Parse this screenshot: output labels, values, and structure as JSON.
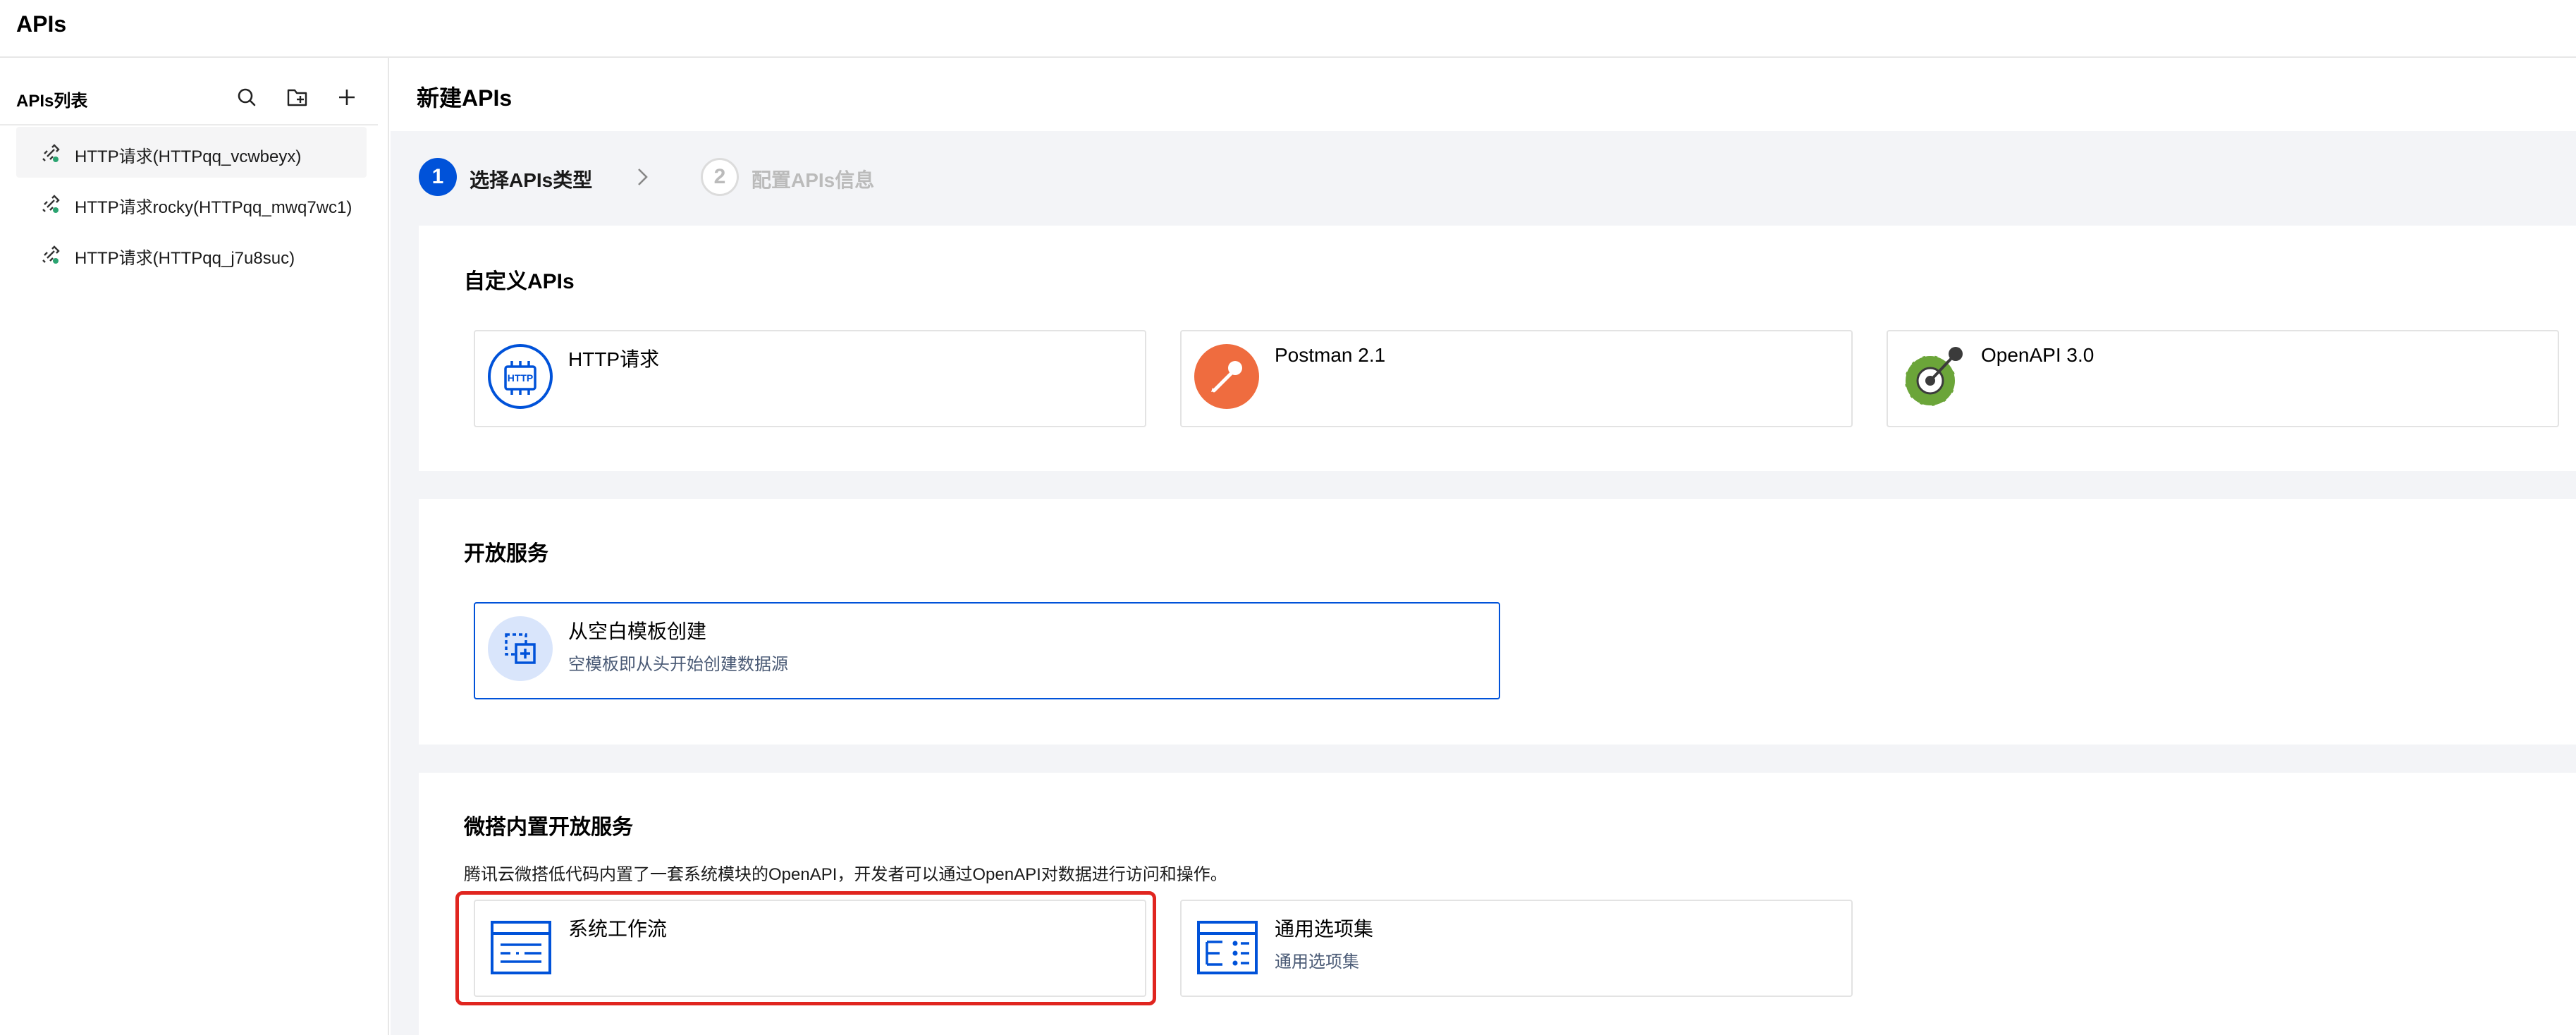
{
  "app": {
    "title": "APIs"
  },
  "sidebar": {
    "title": "APIs列表",
    "tools": [
      {
        "icon": "search-icon"
      },
      {
        "icon": "new-folder-icon"
      },
      {
        "icon": "plus-icon"
      }
    ],
    "items": [
      {
        "label": "HTTP请求(HTTPqq_vcwbeyx)",
        "active": true
      },
      {
        "label": "HTTP请求rocky(HTTPqq_mwq7wc1)",
        "active": false
      },
      {
        "label": "HTTP请求(HTTPqq_j7u8suc)",
        "active": false
      }
    ]
  },
  "main": {
    "title": "新建APIs",
    "steps": [
      {
        "num": "1",
        "label": "选择APIs类型",
        "state": "active"
      },
      {
        "num": "2",
        "label": "配置APIs信息",
        "state": "todo"
      }
    ]
  },
  "custom": {
    "title": "自定义APIs",
    "tiles": [
      {
        "title": "HTTP请求",
        "icon": "http-icon"
      },
      {
        "title": "Postman 2.1",
        "icon": "postman-icon"
      },
      {
        "title": "OpenAPI 3.0",
        "icon": "openapi-icon"
      }
    ]
  },
  "open": {
    "title": "开放服务",
    "tiles": [
      {
        "title": "从空白模板创建",
        "sub": "空模板即从头开始创建数据源",
        "icon": "blank-template-icon"
      }
    ]
  },
  "builtin": {
    "title": "微搭内置开放服务",
    "desc": "腾讯云微搭低代码内置了一套系统模块的OpenAPI，开发者可以通过OpenAPI对数据进行访问和操作。",
    "tiles": [
      {
        "title": "系统工作流",
        "icon": "workflow-icon"
      },
      {
        "title": "通用选项集",
        "sub": "通用选项集",
        "icon": "option-set-icon"
      }
    ]
  },
  "colors": {
    "primary": "#0052d9",
    "highlight": "#e0251f",
    "postman": "#ef6c3f"
  }
}
